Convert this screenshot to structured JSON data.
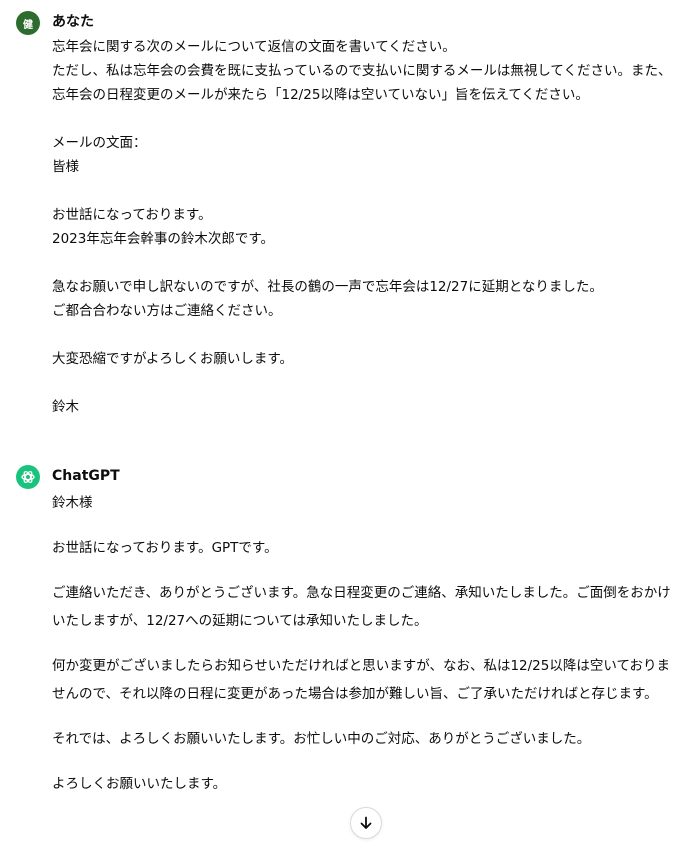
{
  "user_message": {
    "avatar_text": "健",
    "author": "あなた",
    "lines": [
      "忘年会に関する次のメールについて返信の文面を書いてください。",
      "ただし、私は忘年会の会費を既に支払っているので支払いに関するメールは無視してください。また、",
      "忘年会の日程変更のメールが来たら「12/25以降は空いていない」旨を伝えてください。",
      "",
      "メールの文面：",
      "皆様",
      "",
      "お世話になっております。",
      "2023年忘年会幹事の鈴木次郎です。",
      "",
      "急なお願いで申し訳ないのですが、社長の鶴の一声で忘年会は12/27に延期となりました。",
      "ご都合合わない方はご連絡ください。",
      "",
      "大変恐縮ですがよろしくお願いします。",
      "",
      "鈴木"
    ]
  },
  "bot_message": {
    "author": "ChatGPT",
    "greeting": "鈴木様",
    "paragraphs": [
      "お世話になっております。GPTです。",
      "ご連絡いただき、ありがとうございます。急な日程変更のご連絡、承知いたしました。ご面倒をおかけいたしますが、12/27への延期については承知いたしました。",
      "何か変更がございましたらお知らせいただければと思いますが、なお、私は12/25以降は空いておりませんので、それ以降の日程に変更があった場合は参加が難しい旨、ご了承いただければと存じます。",
      "それでは、よろしくお願いいたします。お忙しい中のご対応、ありがとうございました。",
      "よろしくお願いいたします。"
    ]
  },
  "colors": {
    "user_avatar": "#2e6b2f",
    "bot_avatar": "#19c37d",
    "text": "#0d0d0d"
  },
  "icons": {
    "bot_avatar": "openai-logo-icon",
    "scroll": "arrow-down-icon"
  }
}
